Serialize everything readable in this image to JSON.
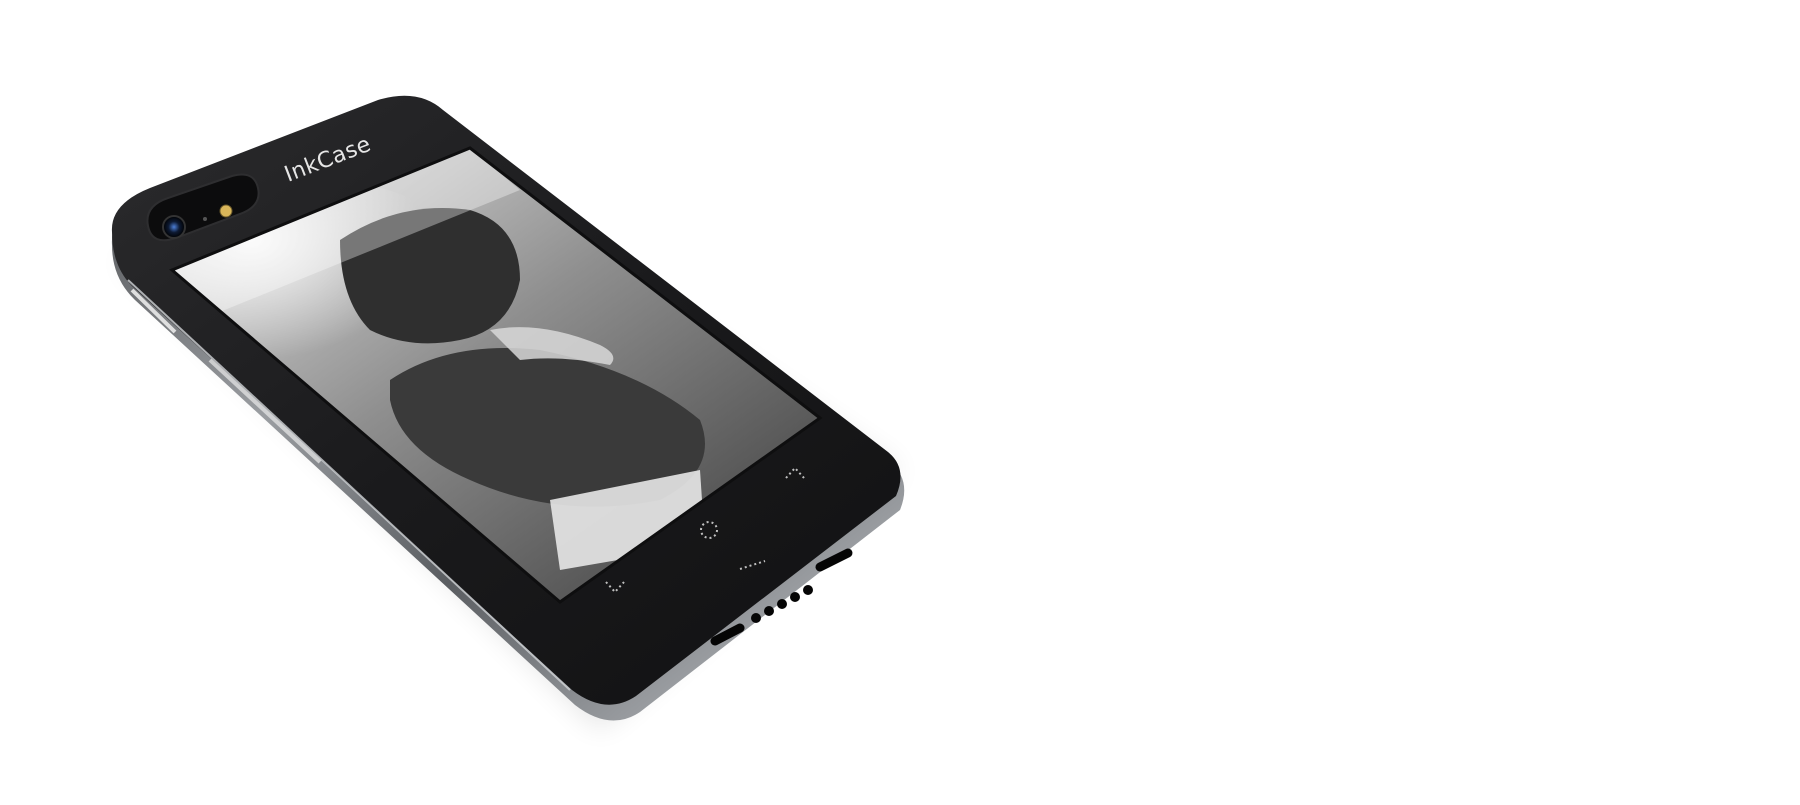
{
  "product": {
    "brand_label": "InkCase"
  },
  "screen": {
    "content": "monochrome-photo"
  },
  "controls": {
    "up_icon": "chevron-up-icon",
    "home_icon": "dotted-circle-icon",
    "menu_icon": "dotted-line-icon",
    "down_icon": "chevron-down-icon"
  },
  "colors": {
    "background": "#ffffff",
    "case_body": "#1c1c1e",
    "frame_metal": "#8a8d90"
  }
}
